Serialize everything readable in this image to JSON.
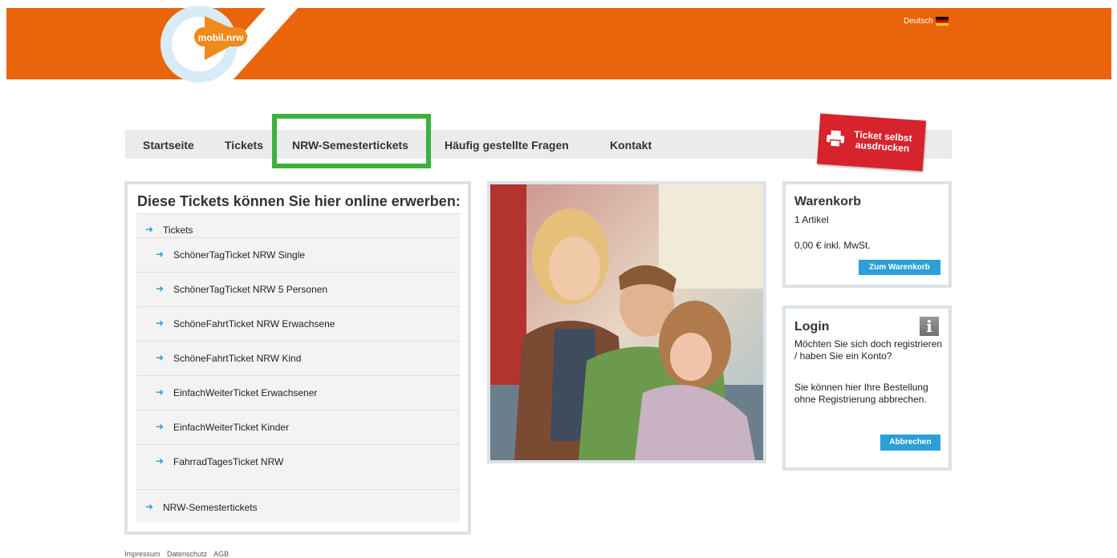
{
  "header": {
    "logo_text": "mobil.nrw",
    "language": "Deutsch"
  },
  "nav": [
    {
      "label": "Startseite"
    },
    {
      "label": "Tickets"
    },
    {
      "label": "NRW-Semestertickets"
    },
    {
      "label": "Häufig gestellte Fragen"
    },
    {
      "label": "Kontakt"
    }
  ],
  "print_button": {
    "line1": "Ticket selbst",
    "line2": "ausdrucken"
  },
  "tickets": {
    "title": "Diese Tickets können Sie hier online erwerben:",
    "group1": "Tickets",
    "items": [
      "SchönerTagTicket NRW Single",
      "SchönerTagTicket NRW 5 Personen",
      "SchöneFahrtTicket NRW Erwachsene",
      "SchöneFahrtTicket NRW Kind",
      "EinfachWeiterTicket Erwachsener",
      "EinfachWeiterTicket Kinder",
      "FahrradTagesTicket NRW"
    ],
    "group2": "NRW-Semestertickets"
  },
  "cart": {
    "title": "Warenkorb",
    "count": "1 Artikel",
    "total": "0,00 € inkl. MwSt.",
    "button": "Zum Warenkorb"
  },
  "login": {
    "title": "Login",
    "text1": "Möchten Sie sich doch registrieren / haben Sie ein Konto?",
    "text2": "Sie können hier Ihre Bestellung ohne Registrierung abbrechen.",
    "button": "Abbrechen"
  },
  "footer": [
    "Impressum",
    "Datenschutz",
    "AGB"
  ],
  "colors": {
    "brand": "#ea640b",
    "accent": "#2a9fd8",
    "highlight": "#3db13d",
    "print": "#d7232c"
  }
}
